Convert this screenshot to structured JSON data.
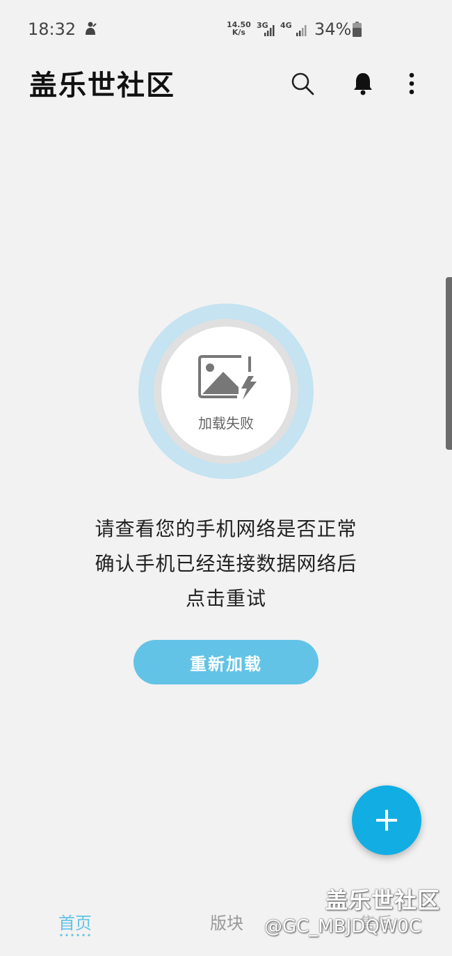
{
  "status_bar": {
    "time": "18:32",
    "net_speed_value": "14.50",
    "net_speed_unit": "K/s",
    "sim1_type": "3G",
    "sim2_type": "4G",
    "battery": "34%"
  },
  "app_bar": {
    "title": "盖乐世社区",
    "icons": [
      "search-icon",
      "bell-icon",
      "more-vert-icon"
    ]
  },
  "error": {
    "image_label": "加载失败",
    "message_lines": [
      "请查看您的手机网络是否正常",
      "确认手机已经连接数据网络后",
      "点击重试"
    ],
    "retry_label": "重新加载"
  },
  "fab": {
    "icon": "plus-icon"
  },
  "bottom_nav": {
    "items": [
      {
        "label": "首页",
        "active": true
      },
      {
        "label": "版块",
        "active": false
      },
      {
        "label": "售后",
        "active": false
      }
    ]
  },
  "watermark": {
    "title": "盖乐世社区",
    "handle": "@GC_MBJDQW0C"
  },
  "colors": {
    "accent": "#62c3e6",
    "fab": "#12aee3",
    "background": "#f2f2f2"
  }
}
